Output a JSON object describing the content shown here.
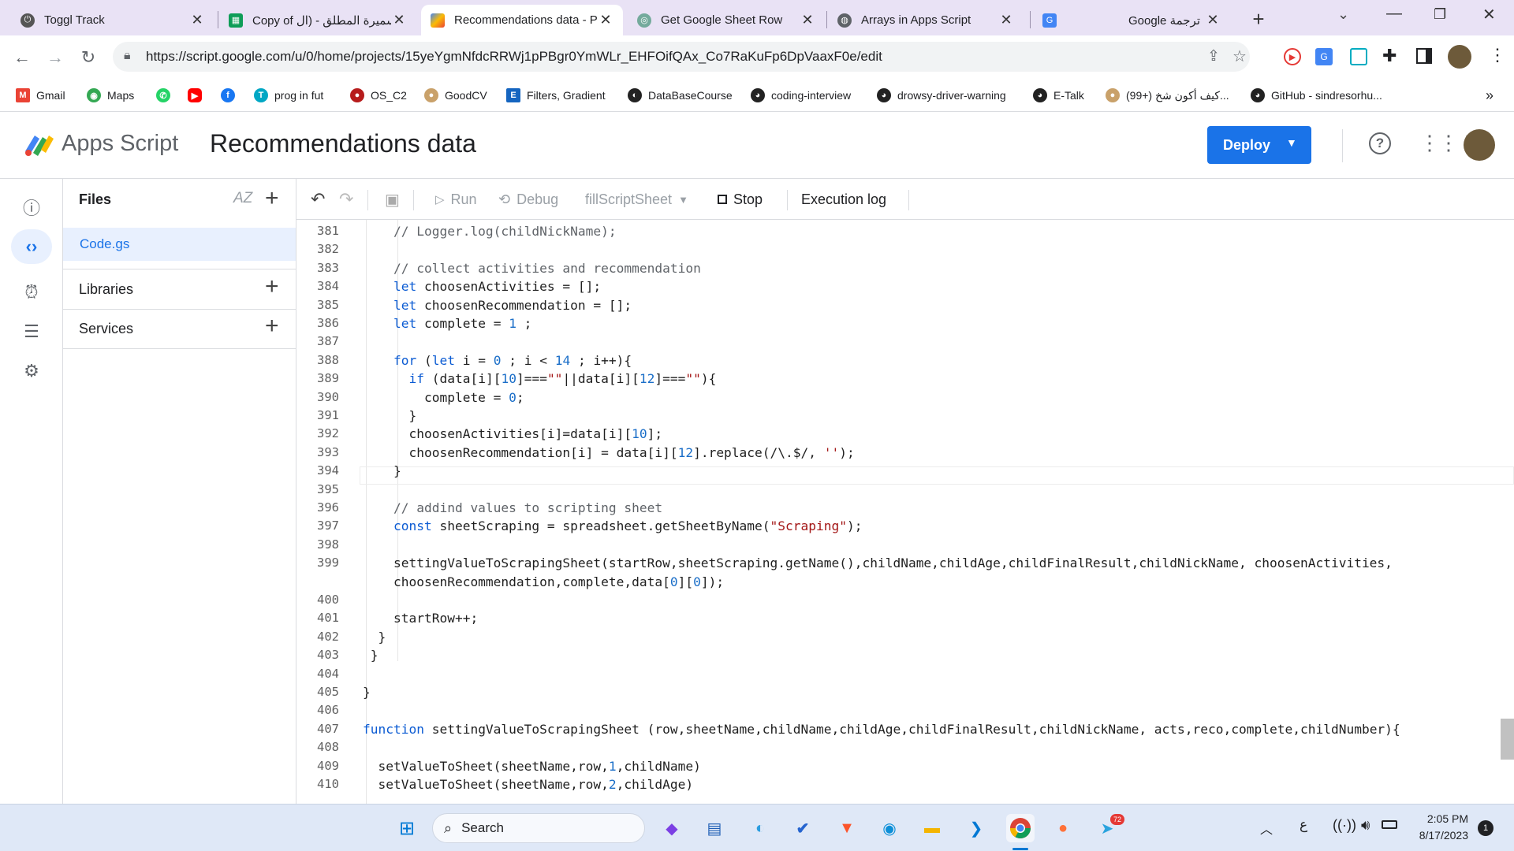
{
  "tabs": [
    {
      "title": "Toggl Track",
      "icon": "toggl-icon",
      "color": "#555555"
    },
    {
      "title": "Copy of سميرة المطلق - (ال",
      "icon": "sheets-icon",
      "color": "#0f9d58"
    },
    {
      "title": "Recommendations data - Pr",
      "icon": "apps-script-icon",
      "color": "#4285f4",
      "active": true
    },
    {
      "title": "Get Google Sheet Row",
      "icon": "chatgpt-icon",
      "color": "#74aa9c"
    },
    {
      "title": "Arrays in Apps Script",
      "icon": "globe-icon",
      "color": "#5f6368"
    },
    {
      "title": "Google ترجمة",
      "icon": "translate-icon",
      "color": "#4285f4"
    }
  ],
  "new_tab": "+",
  "address": {
    "url": "https://script.google.com/u/0/home/projects/15yeYgmNfdcRRWj1pPBgr0YmWLr_EHFOifQAx_Co7RaKuFp6DpVaaxF0e/edit"
  },
  "bookmarks": [
    {
      "label": "Gmail",
      "color": "#ea4335",
      "icon": "gmail-icon"
    },
    {
      "label": "Maps",
      "color": "#34a853",
      "icon": "maps-icon"
    },
    {
      "label": "",
      "color": "#25d366",
      "icon": "whatsapp-icon"
    },
    {
      "label": "",
      "color": "#ff0000",
      "icon": "youtube-icon"
    },
    {
      "label": "",
      "color": "#1877f2",
      "icon": "facebook-icon"
    },
    {
      "label": "prog in fut",
      "color": "#00a7c4",
      "icon": "prog-icon"
    },
    {
      "label": "OS_C2",
      "color": "#b71c1c",
      "icon": "os-icon"
    },
    {
      "label": "GoodCV",
      "color": "#c9a16a",
      "icon": "goodcv-icon"
    },
    {
      "label": "Filters, Gradient",
      "color": "#1565c0",
      "icon": "e-icon"
    },
    {
      "label": "DataBaseCourse",
      "color": "#222222",
      "icon": "db-icon"
    },
    {
      "label": "coding-interview",
      "color": "#222222",
      "icon": "github-icon"
    },
    {
      "label": "drowsy-driver-warning",
      "color": "#222222",
      "icon": "github-icon"
    },
    {
      "label": "E-Talk",
      "color": "#222222",
      "icon": "github-icon"
    },
    {
      "label": "(99+) كيف أكون شخ...",
      "color": "#c9a16a",
      "icon": "quora-icon"
    },
    {
      "label": "GitHub - sindresorhu...",
      "color": "#222222",
      "icon": "github-icon"
    }
  ],
  "bookmarks_more": "»",
  "app": {
    "product": "Apps Script",
    "project_title": "Recommendations data",
    "deploy_label": "Deploy"
  },
  "files_panel": {
    "files_label": "Files",
    "sort_label": "AZ",
    "file": "Code.gs",
    "libraries_label": "Libraries",
    "services_label": "Services"
  },
  "toolbar": {
    "run": "Run",
    "debug": "Debug",
    "function": "fillScriptSheet",
    "stop": "Stop",
    "exec_log": "Execution log"
  },
  "code_lines": [
    {
      "n": "381",
      "t": "    // Logger.log(childNickName);"
    },
    {
      "n": "382",
      "t": ""
    },
    {
      "n": "383",
      "t": "    // collect activities and recommendation"
    },
    {
      "n": "384",
      "t": "    let choosenActivities = [];"
    },
    {
      "n": "385",
      "t": "    let choosenRecommendation = [];"
    },
    {
      "n": "386",
      "t": "    let complete = 1 ;"
    },
    {
      "n": "387",
      "t": ""
    },
    {
      "n": "388",
      "t": "    for (let i = 0 ; i < 14 ; i++){"
    },
    {
      "n": "389",
      "t": "      if (data[i][10]===\"\"||data[i][12]===\"\"){"
    },
    {
      "n": "390",
      "t": "        complete = 0;"
    },
    {
      "n": "391",
      "t": "      }"
    },
    {
      "n": "392",
      "t": "      choosenActivities[i]=data[i][10];"
    },
    {
      "n": "393",
      "t": "      choosenRecommendation[i] = data[i][12].replace(/\\.$/, '');"
    },
    {
      "n": "394",
      "t": "    }"
    },
    {
      "n": "395",
      "t": ""
    },
    {
      "n": "396",
      "t": "    // addind values to scripting sheet"
    },
    {
      "n": "397",
      "t": "    const sheetScraping = spreadsheet.getSheetByName(\"Scraping\");"
    },
    {
      "n": "398",
      "t": ""
    },
    {
      "n": "399",
      "t": "    settingValueToScrapingSheet(startRow,sheetScraping.getName(),childName,childAge,childFinalResult,childNickName, choosenActivities,"
    },
    {
      "n": "",
      "t": "    choosenRecommendation,complete,data[0][0]);"
    },
    {
      "n": "400",
      "t": ""
    },
    {
      "n": "401",
      "t": "    startRow++;"
    },
    {
      "n": "402",
      "t": "  }"
    },
    {
      "n": "403",
      "t": " }"
    },
    {
      "n": "404",
      "t": ""
    },
    {
      "n": "405",
      "t": "}"
    },
    {
      "n": "406",
      "t": ""
    },
    {
      "n": "407",
      "t": "function settingValueToScrapingSheet (row,sheetName,childName,childAge,childFinalResult,childNickName, acts,reco,complete,childNumber){"
    },
    {
      "n": "408",
      "t": ""
    },
    {
      "n": "409",
      "t": "  setValueToSheet(sheetName,row,1,childName)"
    },
    {
      "n": "410",
      "t": "  setValueToSheet(sheetName,row,2,childAge)"
    }
  ],
  "taskbar": {
    "search_label": "Search",
    "time": "2:05 PM",
    "date": "8/17/2023",
    "lang": "ع",
    "notif_count": "1",
    "telegram_badge": "72"
  }
}
